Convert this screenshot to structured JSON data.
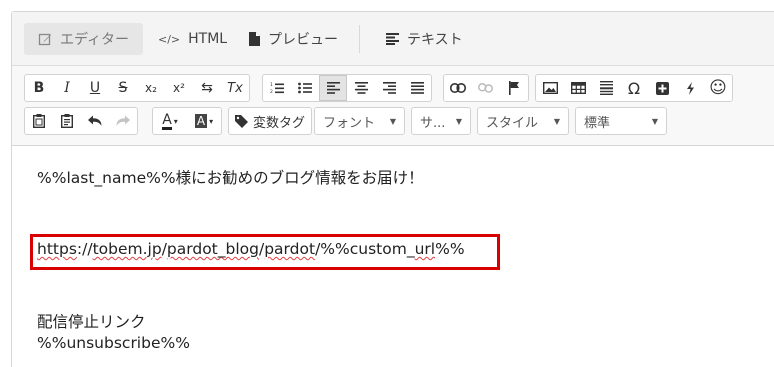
{
  "tabs": [
    {
      "label": "エディター",
      "icon": "pencil-icon",
      "active": true
    },
    {
      "label": "HTML",
      "icon": "code-icon",
      "active": false
    },
    {
      "label": "プレビュー",
      "icon": "document-icon",
      "active": false
    },
    {
      "label": "テキスト",
      "icon": "text-lines-icon",
      "active": false
    }
  ],
  "toolbar": {
    "row1": {
      "format": [
        "B",
        "I",
        "U",
        "S",
        "x₂",
        "x²",
        "⇆",
        "Tx"
      ],
      "lists": [
        "numbered-list",
        "bullet-list",
        "align-left",
        "align-center",
        "align-right",
        "justify"
      ],
      "links": [
        "link",
        "unlink",
        "anchor-flag"
      ],
      "insert": [
        "image",
        "table",
        "horizontal-rule",
        "Ω",
        "plus",
        "lightning",
        "☺"
      ]
    },
    "row2": {
      "variable_tag": "変数タグ",
      "font": "フォント",
      "size": "サ...",
      "style": "スタイル",
      "format": "標準"
    }
  },
  "content": {
    "line1": "%%last_name%%様にお勧めのブログ情報をお届け！",
    "url_parts": [
      "https",
      "://",
      "tobem.jp",
      "/",
      "pardot_blog",
      "/",
      "pardot",
      "/%%custom_",
      "url",
      "%%"
    ],
    "line3": "配信停止リンク",
    "line4": "%%unsubscribe%%"
  },
  "colors": {
    "highlight": "#d80000",
    "spellcheck": "#e04040"
  }
}
